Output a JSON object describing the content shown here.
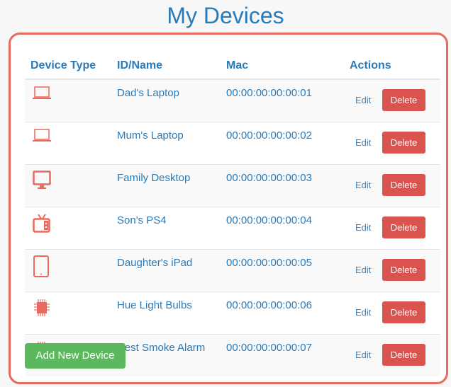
{
  "page": {
    "title": "My Devices"
  },
  "colors": {
    "accent": "#2a7ab8",
    "panel_border": "#e8695d",
    "icon": "#e8695d",
    "delete": "#d9534f",
    "add": "#5cb85c"
  },
  "table": {
    "headers": {
      "type": "Device Type",
      "name": "ID/Name",
      "mac": "Mac",
      "actions": "Actions"
    },
    "rows": [
      {
        "icon": "laptop-icon",
        "name": "Dad's Laptop",
        "mac": "00:00:00:00:00:01",
        "edit": "Edit",
        "delete": "Delete"
      },
      {
        "icon": "laptop-icon",
        "name": "Mum's Laptop",
        "mac": "00:00:00:00:00:02",
        "edit": "Edit",
        "delete": "Delete"
      },
      {
        "icon": "desktop-icon",
        "name": "Family Desktop",
        "mac": "00:00:00:00:00:03",
        "edit": "Edit",
        "delete": "Delete"
      },
      {
        "icon": "tv-icon",
        "name": "Son's PS4",
        "mac": "00:00:00:00:00:04",
        "edit": "Edit",
        "delete": "Delete"
      },
      {
        "icon": "tablet-icon",
        "name": "Daughter's iPad",
        "mac": "00:00:00:00:00:05",
        "edit": "Edit",
        "delete": "Delete"
      },
      {
        "icon": "chip-icon",
        "name": "Hue Light Bulbs",
        "mac": "00:00:00:00:00:06",
        "edit": "Edit",
        "delete": "Delete"
      },
      {
        "icon": "chip-icon",
        "name": "Nest Smoke Alarm",
        "mac": "00:00:00:00:00:07",
        "edit": "Edit",
        "delete": "Delete"
      }
    ]
  },
  "add_button": {
    "label": "Add New Device"
  }
}
